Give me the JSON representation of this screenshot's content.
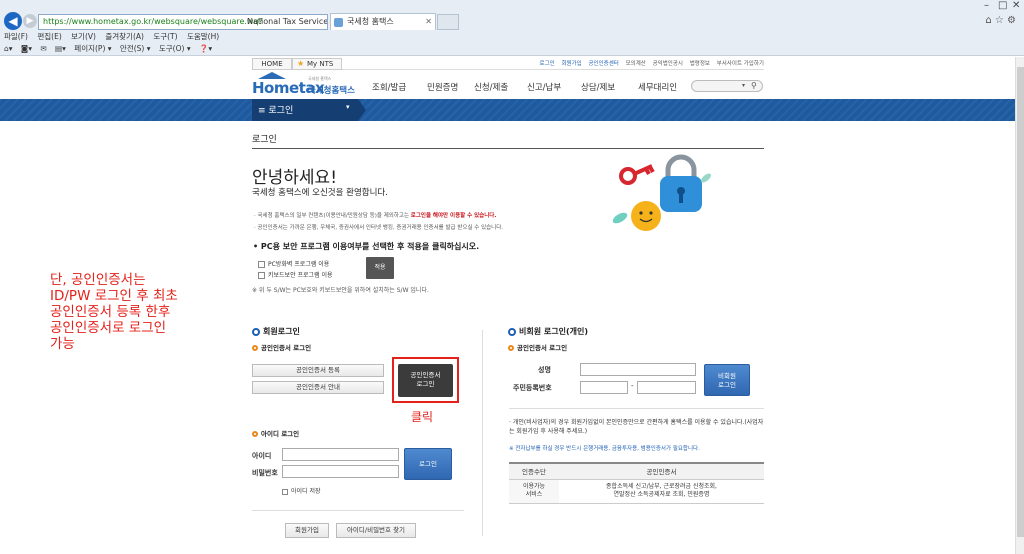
{
  "browser": {
    "url": "https://www.hometax.go.kr/websquare/websquare.wq?",
    "site_identity": "National Tax Service [KR]",
    "tab_title": "국세청 홈택스",
    "menu": [
      "파일(F)",
      "편집(E)",
      "보기(V)",
      "즐겨찾기(A)",
      "도구(T)",
      "도움말(H)"
    ],
    "commands": [
      "페이지(P) ▾",
      "안전(S) ▾",
      "도구(O) ▾"
    ]
  },
  "topnav": {
    "home": "HOME",
    "mynts": "My NTS",
    "util_links": [
      "로그인",
      "회원가입",
      "공인인증센터",
      "모의계산",
      "공익법인공시",
      "법령정보",
      "부서사이트 가입하기"
    ]
  },
  "logo": {
    "main": "Hometax",
    "sub": "국세청홈택스",
    "tiny": "국세청 홈택스"
  },
  "gnb": [
    "조회/발급",
    "민원증명",
    "신청/제출",
    "신고/납부",
    "상담/제보",
    "세무대리인"
  ],
  "login_menu": "≡ 로그인",
  "page_title": "로그인",
  "hello": "안녕하세요!",
  "welcome": "국세청 홈택스에 오신것을 환영합니다.",
  "notice1_pre": "· 국세청 홈택스의 일부 컨텐츠(이용안내/민원상담 등)을 제외하고는 ",
  "notice1_red": "로그인을 해야만 이용할 수 있습니다.",
  "notice2": "· 공인인증서는 가까운 은행, 우체국, 증권사에서 인터넷 뱅킹, 증권거래용 인증서를 발급 받으실 수 있습니다.",
  "pc_question": "• PC용 보안 프로그램 이용여부를 선택한 후 적용을 클릭하십시오.",
  "checkboxes": [
    "PC방화벽 프로그램 이용",
    "키보드보안 프로그램 이용"
  ],
  "apply": "적용",
  "sw_note": "※ 위 두 S/W는 PC보호와 키보드보안을 위하여 설치하는 S/W 입니다.",
  "annotation": "단, 공인인증서는\nID/PW 로그인 후 최초\n공인인증서 등록 한후\n공인인증서로 로그인\n가능",
  "click_label": "클릭",
  "member": {
    "title": "회원로그인",
    "cert_sub": "공인인증서 로그인",
    "register_btn": "공인인증서 등록",
    "guide_btn": "공인인증서 안내",
    "cert_login_btn": "공인인증서\n로그인",
    "id_sub": "아이디 로그인",
    "id_label": "아이디",
    "pw_label": "비밀번호",
    "login_btn": "로그인",
    "save_id": "아이디 저장",
    "join_btn": "회원가입",
    "find_btn": "아이디/비밀번호 찾기"
  },
  "nonmember": {
    "title": "비회원 로그인(개인)",
    "cert_sub": "공인인증서 로그인",
    "name_label": "성명",
    "rrn_label": "주민등록번호",
    "rrn_sep": "-",
    "login_btn": "비회원\n로그인",
    "note": "· 개인(비사업자)의 경우 회원가입없이 본인인증만으로 간편하게 홈택스를 이용할 수 있습니다.(사업자는 회원가입 후 사용해 주세요.)",
    "warn": "※ 전자납부를 하실 경우 반드시 은행거래용, 금융투자용, 범용인증서가 필요합니다.",
    "table": {
      "h1": "인증수단",
      "h2": "공인인증서",
      "r1": "이용가능\n서비스",
      "r2": "종합소득세 신고/납부, 근로장려금 신청조회,\n연말정산 소득공제자료 조회, 민원증명"
    }
  },
  "colors": {
    "brand_blue": "#1e5aa0",
    "annotation_red": "#e4211a",
    "accent_orange": "#e8891d"
  }
}
